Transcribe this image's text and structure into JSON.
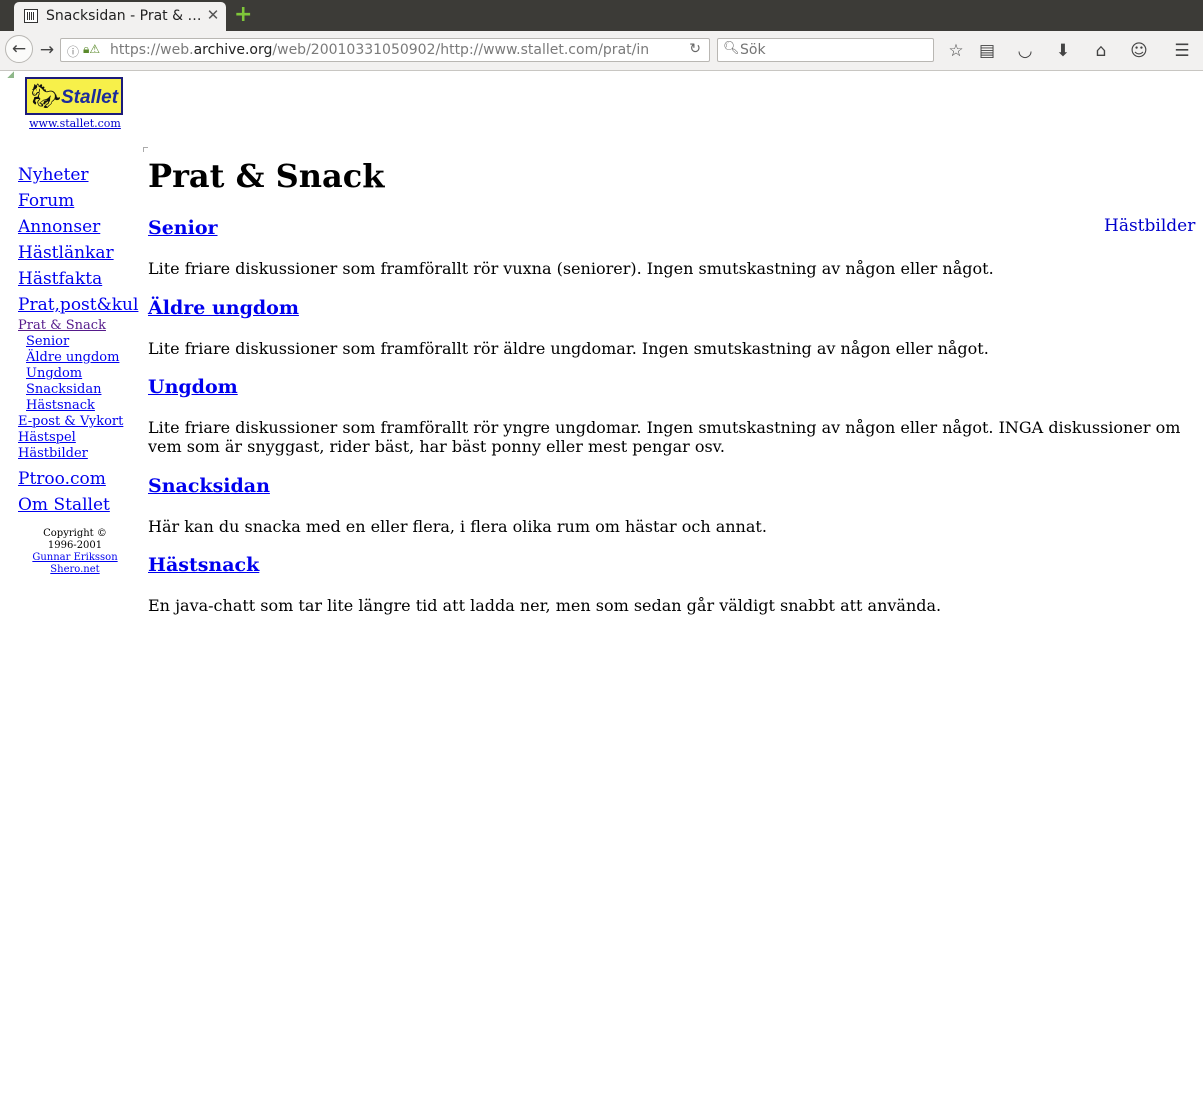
{
  "browser": {
    "tab_title": "Snacksidan - Prat & …",
    "url_prefix": "https://web.",
    "url_domain": "archive.org",
    "url_rest": "/web/20010331050902/http://www.stallet.com/prat/in",
    "search_placeholder": "Sök"
  },
  "sidebar": {
    "logo_text": "Stallet",
    "logo_url": "www.stallet.com",
    "nav_main": [
      {
        "label": "Nyheter"
      },
      {
        "label": "Forum"
      },
      {
        "label": "Annonser"
      },
      {
        "label": "Hästlänkar"
      },
      {
        "label": "Hästfakta"
      },
      {
        "label": "Prat,post&kul"
      }
    ],
    "nav_current": "Prat & Snack",
    "nav_sub": [
      {
        "label": "Senior"
      },
      {
        "label": "Äldre ungdom"
      },
      {
        "label": "Ungdom"
      },
      {
        "label": "Snacksidan"
      },
      {
        "label": "Hästsnack"
      }
    ],
    "nav_small": [
      {
        "label": "E-post & Vykort"
      },
      {
        "label": "Hästspel"
      },
      {
        "label": "Hästbilder"
      }
    ],
    "nav_bottom": [
      {
        "label": "Ptroo.com"
      },
      {
        "label": "Om Stallet"
      }
    ],
    "copyright_line1": "Copyright ©",
    "copyright_line2": "1996-2001",
    "copyright_author": "Gunnar Eriksson",
    "copyright_site": "Shero.net"
  },
  "main": {
    "title": "Prat & Snack",
    "side_link": "Hästbilder",
    "sections": [
      {
        "title": "Senior",
        "desc": "Lite friare diskussioner som framförallt rör vuxna (seniorer). Ingen smutskastning av någon eller något."
      },
      {
        "title": "Äldre ungdom",
        "desc": "Lite friare diskussioner som framförallt rör äldre ungdomar. Ingen smutskastning av någon eller något."
      },
      {
        "title": "Ungdom",
        "desc": "Lite friare diskussioner som framförallt rör yngre ungdomar. Ingen smutskastning av någon eller något. INGA diskussioner om vem som är snyggast, rider bäst, har bäst ponny eller mest pengar osv."
      },
      {
        "title": "Snacksidan",
        "desc": "Här kan du snacka med en eller flera, i flera olika rum om hästar och annat."
      },
      {
        "title": "Hästsnack",
        "desc": "En java-chatt som tar lite längre tid att ladda ner, men som sedan går väldigt snabbt att använda."
      }
    ]
  },
  "colors": {
    "link": "#0000ee",
    "visited_link": "#551a8b",
    "logo_bg": "#f7f04a",
    "logo_text": "#1c2c9c",
    "tabbar_bg": "#3c3b37",
    "toolbar_bg": "#f2f1f0"
  }
}
